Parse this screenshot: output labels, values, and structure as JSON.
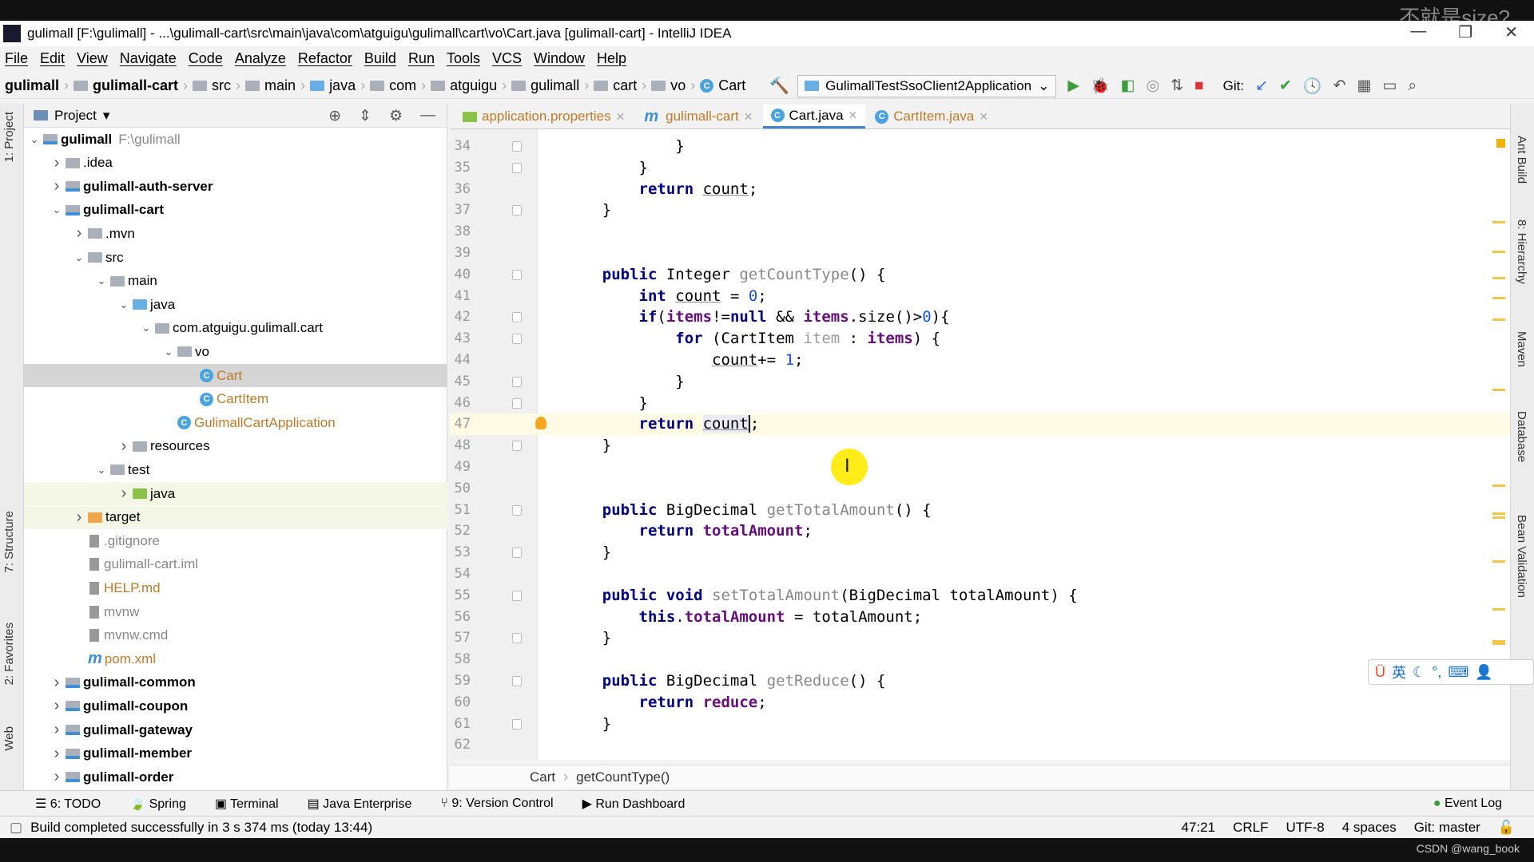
{
  "window": {
    "title": "gulimall [F:\\gulimall] - ...\\gulimall-cart\\src\\main\\java\\com\\atguigu\\gulimall\\cart\\vo\\Cart.java [gulimall-cart] - IntelliJ IDEA",
    "app_icon": "IJ",
    "overlay_text": "不就是size?"
  },
  "menu": [
    "File",
    "Edit",
    "View",
    "Navigate",
    "Code",
    "Analyze",
    "Refactor",
    "Build",
    "Run",
    "Tools",
    "VCS",
    "Window",
    "Help"
  ],
  "breadcrumb": [
    "gulimall",
    "gulimall-cart",
    "src",
    "main",
    "java",
    "com",
    "atguigu",
    "gulimall",
    "cart",
    "vo",
    "Cart"
  ],
  "run_config": "GulimallTestSsoClient2Application",
  "git_label": "Git:",
  "left_tabs": [
    "1: Project",
    "7: Structure",
    "2: Favorites",
    "Web"
  ],
  "right_tabs": [
    "Ant Build",
    "8: Hierarchy",
    "Maven",
    "Database",
    "Bean Validation"
  ],
  "project": {
    "header": "Project",
    "tree": [
      {
        "label": "gulimall",
        "extra": "F:\\gulimall",
        "depth": 0,
        "arrow": "down",
        "icon": "module",
        "bold": true
      },
      {
        "label": ".idea",
        "depth": 1,
        "arrow": "right",
        "icon": "folder"
      },
      {
        "label": "gulimall-auth-server",
        "depth": 1,
        "arrow": "right",
        "icon": "module",
        "bold": true
      },
      {
        "label": "gulimall-cart",
        "depth": 1,
        "arrow": "down",
        "icon": "module",
        "bold": true
      },
      {
        "label": ".mvn",
        "depth": 2,
        "arrow": "right",
        "icon": "folder"
      },
      {
        "label": "src",
        "depth": 2,
        "arrow": "down",
        "icon": "folder"
      },
      {
        "label": "main",
        "depth": 3,
        "arrow": "down",
        "icon": "folder"
      },
      {
        "label": "java",
        "depth": 4,
        "arrow": "down",
        "icon": "folder-blue"
      },
      {
        "label": "com.atguigu.gulimall.cart",
        "depth": 5,
        "arrow": "down",
        "icon": "package"
      },
      {
        "label": "vo",
        "depth": 6,
        "arrow": "down",
        "icon": "package"
      },
      {
        "label": "Cart",
        "depth": 7,
        "arrow": "",
        "icon": "class",
        "color": "#bd7a2a",
        "selected": true
      },
      {
        "label": "CartItem",
        "depth": 7,
        "arrow": "",
        "icon": "class",
        "color": "#bd7a2a"
      },
      {
        "label": "GulimallCartApplication",
        "depth": 6,
        "arrow": "",
        "icon": "class",
        "color": "#bd7a2a"
      },
      {
        "label": "resources",
        "depth": 4,
        "arrow": "right",
        "icon": "folder"
      },
      {
        "label": "test",
        "depth": 3,
        "arrow": "down",
        "icon": "folder"
      },
      {
        "label": "java",
        "depth": 4,
        "arrow": "right",
        "icon": "folder-green",
        "highlight": true
      },
      {
        "label": "target",
        "depth": 2,
        "arrow": "right",
        "icon": "folder-orange",
        "highlight": true
      },
      {
        "label": ".gitignore",
        "depth": 2,
        "arrow": "",
        "icon": "file",
        "color": "#888"
      },
      {
        "label": "gulimall-cart.iml",
        "depth": 2,
        "arrow": "",
        "icon": "file",
        "color": "#888"
      },
      {
        "label": "HELP.md",
        "depth": 2,
        "arrow": "",
        "icon": "file",
        "color": "#bd7a2a"
      },
      {
        "label": "mvnw",
        "depth": 2,
        "arrow": "",
        "icon": "file",
        "color": "#888"
      },
      {
        "label": "mvnw.cmd",
        "depth": 2,
        "arrow": "",
        "icon": "file",
        "color": "#888"
      },
      {
        "label": "pom.xml",
        "depth": 2,
        "arrow": "",
        "icon": "maven",
        "color": "#bd7a2a"
      },
      {
        "label": "gulimall-common",
        "depth": 1,
        "arrow": "right",
        "icon": "module",
        "bold": true
      },
      {
        "label": "gulimall-coupon",
        "depth": 1,
        "arrow": "right",
        "icon": "module",
        "bold": true
      },
      {
        "label": "gulimall-gateway",
        "depth": 1,
        "arrow": "right",
        "icon": "module",
        "bold": true
      },
      {
        "label": "gulimall-member",
        "depth": 1,
        "arrow": "right",
        "icon": "module",
        "bold": true
      },
      {
        "label": "gulimall-order",
        "depth": 1,
        "arrow": "right",
        "icon": "module",
        "bold": true
      }
    ]
  },
  "tabs": [
    {
      "label": "application.properties",
      "icon": "properties"
    },
    {
      "label": "gulimall-cart",
      "icon": "maven"
    },
    {
      "label": "Cart.java",
      "icon": "class",
      "active": true
    },
    {
      "label": "CartItem.java",
      "icon": "class"
    }
  ],
  "editor": {
    "current_line": 47,
    "lines": [
      {
        "n": 34,
        "t": [
          [
            "            }",
            ""
          ]
        ]
      },
      {
        "n": 35,
        "t": [
          [
            "        }",
            ""
          ]
        ]
      },
      {
        "n": 36,
        "t": [
          [
            "        ",
            ""
          ],
          [
            "return",
            "kw"
          ],
          [
            " ",
            ""
          ],
          [
            "count",
            "loc"
          ],
          [
            ";",
            ""
          ]
        ]
      },
      {
        "n": 37,
        "t": [
          [
            "    }",
            ""
          ]
        ]
      },
      {
        "n": 38,
        "t": []
      },
      {
        "n": 39,
        "t": []
      },
      {
        "n": 40,
        "t": [
          [
            "    ",
            ""
          ],
          [
            "public",
            "kw"
          ],
          [
            " Integer ",
            ""
          ],
          [
            "getCountType",
            "fn"
          ],
          [
            "() {",
            ""
          ]
        ]
      },
      {
        "n": 41,
        "t": [
          [
            "        ",
            ""
          ],
          [
            "int",
            "kw"
          ],
          [
            " ",
            ""
          ],
          [
            "count",
            "loc"
          ],
          [
            " = ",
            ""
          ],
          [
            "0",
            "num"
          ],
          [
            ";",
            ""
          ]
        ]
      },
      {
        "n": 42,
        "t": [
          [
            "        ",
            ""
          ],
          [
            "if",
            "kw"
          ],
          [
            "(",
            ""
          ],
          [
            "items",
            "fld"
          ],
          [
            "!=",
            ""
          ],
          [
            "null",
            "kw"
          ],
          [
            " && ",
            ""
          ],
          [
            "items",
            "fld"
          ],
          [
            ".size()>",
            ""
          ],
          [
            "0",
            "num"
          ],
          [
            "){",
            ""
          ]
        ]
      },
      {
        "n": 43,
        "t": [
          [
            "            ",
            ""
          ],
          [
            "for",
            "kw"
          ],
          [
            " (CartItem ",
            ""
          ],
          [
            "item",
            "unused"
          ],
          [
            " : ",
            ""
          ],
          [
            "items",
            "fld"
          ],
          [
            ") {",
            ""
          ]
        ]
      },
      {
        "n": 44,
        "t": [
          [
            "                ",
            ""
          ],
          [
            "count",
            "loc"
          ],
          [
            "+= ",
            ""
          ],
          [
            "1",
            "num"
          ],
          [
            ";",
            ""
          ]
        ]
      },
      {
        "n": 45,
        "t": [
          [
            "            }",
            ""
          ]
        ]
      },
      {
        "n": 46,
        "t": [
          [
            "        }",
            ""
          ]
        ]
      },
      {
        "n": 47,
        "t": [
          [
            "        ",
            ""
          ],
          [
            "return",
            "kw"
          ],
          [
            " ",
            ""
          ],
          [
            "count",
            "loc"
          ],
          [
            ";",
            ""
          ]
        ]
      },
      {
        "n": 48,
        "t": [
          [
            "    }",
            ""
          ]
        ]
      },
      {
        "n": 49,
        "t": []
      },
      {
        "n": 50,
        "t": []
      },
      {
        "n": 51,
        "t": [
          [
            "    ",
            ""
          ],
          [
            "public",
            "kw"
          ],
          [
            " BigDecimal ",
            ""
          ],
          [
            "getTotalAmount",
            "fn"
          ],
          [
            "() {",
            ""
          ]
        ]
      },
      {
        "n": 52,
        "t": [
          [
            "        ",
            ""
          ],
          [
            "return",
            "kw"
          ],
          [
            " ",
            ""
          ],
          [
            "totalAmount",
            "fld"
          ],
          [
            ";",
            ""
          ]
        ]
      },
      {
        "n": 53,
        "t": [
          [
            "    }",
            ""
          ]
        ]
      },
      {
        "n": 54,
        "t": []
      },
      {
        "n": 55,
        "t": [
          [
            "    ",
            ""
          ],
          [
            "public",
            "kw"
          ],
          [
            " ",
            ""
          ],
          [
            "void",
            "kw"
          ],
          [
            " ",
            ""
          ],
          [
            "setTotalAmount",
            "fn"
          ],
          [
            "(BigDecimal totalAmount) {",
            ""
          ]
        ]
      },
      {
        "n": 56,
        "t": [
          [
            "        ",
            ""
          ],
          [
            "this",
            "kw"
          ],
          [
            ".",
            ""
          ],
          [
            "totalAmount",
            "fld"
          ],
          [
            " = totalAmount;",
            ""
          ]
        ]
      },
      {
        "n": 57,
        "t": [
          [
            "    }",
            ""
          ]
        ]
      },
      {
        "n": 58,
        "t": []
      },
      {
        "n": 59,
        "t": [
          [
            "    ",
            ""
          ],
          [
            "public",
            "kw"
          ],
          [
            " BigDecimal ",
            ""
          ],
          [
            "getReduce",
            "fn"
          ],
          [
            "() {",
            ""
          ]
        ]
      },
      {
        "n": 60,
        "t": [
          [
            "        ",
            ""
          ],
          [
            "return",
            "kw"
          ],
          [
            " ",
            ""
          ],
          [
            "reduce",
            "fld"
          ],
          [
            ";",
            ""
          ]
        ]
      },
      {
        "n": 61,
        "t": [
          [
            "    }",
            ""
          ]
        ]
      },
      {
        "n": 62,
        "t": []
      }
    ],
    "fold_lines": [
      34,
      35,
      37,
      40,
      42,
      43,
      45,
      46,
      48,
      51,
      53,
      55,
      57,
      59,
      61
    ]
  },
  "editor_breadcrumb": [
    "Cart",
    "getCountType()"
  ],
  "tool_windows": [
    "6: TODO",
    "Spring",
    "Terminal",
    "Java Enterprise",
    "9: Version Control",
    "Run Dashboard"
  ],
  "event_log": "Event Log",
  "status": {
    "message": "Build completed successfully in 3 s 374 ms (today 13:44)",
    "position": "47:21",
    "line_sep": "CRLF",
    "encoding": "UTF-8",
    "indent": "4 spaces",
    "git": "Git: master"
  },
  "ime": {
    "lang": "英"
  },
  "credit": "CSDN @wang_book"
}
